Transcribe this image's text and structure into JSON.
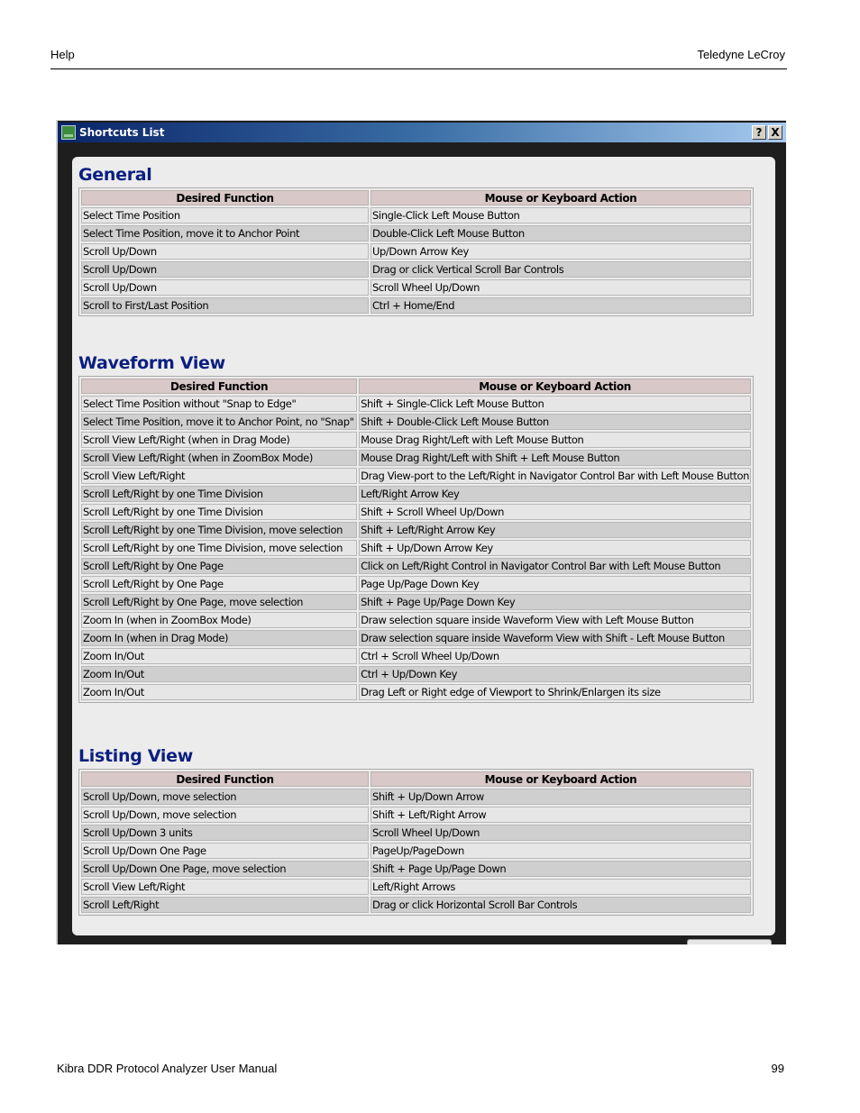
{
  "page": {
    "header_left": "Help",
    "header_right": "Teledyne LeCroy",
    "footer_left": "Kibra DDR Protocol Analyzer User Manual",
    "footer_right": "99"
  },
  "window": {
    "title": "Shortcuts List",
    "help_button": "?",
    "close_button": "X"
  },
  "columns": [
    "Desired Function",
    "Mouse or Keyboard Action"
  ],
  "sections": [
    {
      "title": "General",
      "rows": [
        [
          "Select Time Position",
          "Single-Click Left Mouse Button"
        ],
        [
          "Select Time Position, move it to Anchor Point",
          "Double-Click Left Mouse Button"
        ],
        [
          "Scroll Up/Down",
          "Up/Down Arrow Key"
        ],
        [
          "Scroll Up/Down",
          "Drag or click Vertical Scroll Bar Controls"
        ],
        [
          "Scroll Up/Down",
          "Scroll Wheel Up/Down"
        ],
        [
          "Scroll to First/Last Position",
          "Ctrl + Home/End"
        ]
      ]
    },
    {
      "title": "Waveform View",
      "rows": [
        [
          "Select Time Position without \"Snap to Edge\"",
          "Shift + Single-Click Left Mouse Button"
        ],
        [
          "Select Time Position, move it to Anchor Point, no \"Snap\"",
          "Shift + Double-Click Left Mouse Button"
        ],
        [
          "Scroll View Left/Right (when in Drag Mode)",
          "Mouse Drag Right/Left with Left Mouse Button"
        ],
        [
          "Scroll View Left/Right (when in ZoomBox Mode)",
          "Mouse Drag Right/Left with Shift + Left Mouse Button"
        ],
        [
          "Scroll View Left/Right",
          "Drag View-port to the Left/Right in Navigator Control Bar with Left Mouse Button"
        ],
        [
          "Scroll Left/Right by one Time Division",
          "Left/Right Arrow Key"
        ],
        [
          "Scroll Left/Right by one Time Division",
          "Shift + Scroll Wheel Up/Down"
        ],
        [
          "Scroll Left/Right by one Time Division, move selection",
          "Shift + Left/Right Arrow Key"
        ],
        [
          "Scroll Left/Right by one Time Division, move selection",
          "Shift + Up/Down Arrow Key"
        ],
        [
          "Scroll Left/Right by One Page",
          "Click on Left/Right Control in Navigator Control Bar with Left Mouse Button"
        ],
        [
          "Scroll Left/Right by One Page",
          "Page Up/Page Down Key"
        ],
        [
          "Scroll Left/Right by One Page, move selection",
          "Shift + Page Up/Page Down Key"
        ],
        [
          "Zoom In (when in ZoomBox Mode)",
          "Draw selection square inside Waveform View with Left Mouse Button"
        ],
        [
          "Zoom In (when in Drag Mode)",
          "Draw selection square inside Waveform View with Shift - Left Mouse Button"
        ],
        [
          "Zoom In/Out",
          "Ctrl + Scroll Wheel Up/Down"
        ],
        [
          "Zoom In/Out",
          "Ctrl + Up/Down Key"
        ],
        [
          "Zoom In/Out",
          "Drag Left or Right edge of Viewport to Shrink/Enlargen its size"
        ]
      ]
    },
    {
      "title": "Listing View",
      "rows": [
        [
          "Scroll Up/Down, move selection",
          "Shift + Up/Down Arrow"
        ],
        [
          "Scroll Up/Down, move selection",
          "Shift + Left/Right Arrow"
        ],
        [
          "Scroll Up/Down 3 units",
          "Scroll Wheel Up/Down"
        ],
        [
          "Scroll Up/Down One Page",
          "PageUp/PageDown"
        ],
        [
          "Scroll Up/Down One Page, move selection",
          "Shift + Page Up/Page Down"
        ],
        [
          "Scroll View Left/Right",
          "Left/Right Arrows"
        ],
        [
          "Scroll Left/Right",
          "Drag or click Horizontal Scroll Bar Controls"
        ]
      ]
    }
  ]
}
